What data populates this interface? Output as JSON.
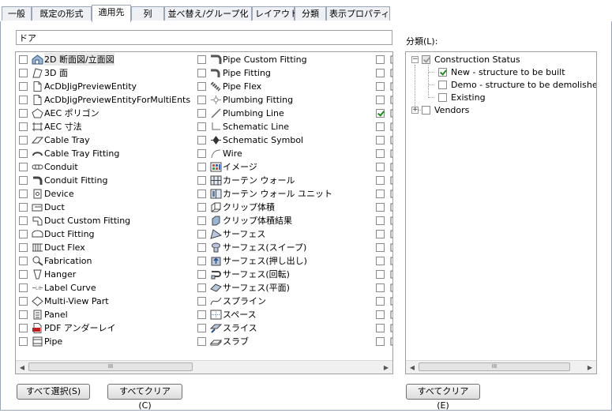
{
  "tabs": [
    "一般",
    "既定の形式",
    "適用先",
    "列",
    "並べ替え/グループ化",
    "レイアウト",
    "分類",
    "表示プロパティ"
  ],
  "active_tab": "適用先",
  "search": {
    "value": "ドア"
  },
  "objects": {
    "col1": [
      {
        "label": "2D 断面図/立面図",
        "checked": false,
        "icon": "section-elevation-icon",
        "selected": true
      },
      {
        "label": "3D 面",
        "checked": false,
        "icon": "3d-face-icon"
      },
      {
        "label": "AcDbJigPreviewEntity",
        "checked": false,
        "icon": "document-icon"
      },
      {
        "label": "AcDbJigPreviewEntityForMultiEnts",
        "checked": false,
        "icon": "document-icon"
      },
      {
        "label": "AEC ポリゴン",
        "checked": false,
        "icon": "polygon-icon"
      },
      {
        "label": "AEC 寸法",
        "checked": false,
        "icon": "dimension-icon"
      },
      {
        "label": "Cable Tray",
        "checked": false,
        "icon": "cable-tray-icon"
      },
      {
        "label": "Cable Tray Fitting",
        "checked": false,
        "icon": "cable-tray-fitting-icon"
      },
      {
        "label": "Conduit",
        "checked": false,
        "icon": "conduit-icon"
      },
      {
        "label": "Conduit Fitting",
        "checked": false,
        "icon": "conduit-fitting-icon"
      },
      {
        "label": "Device",
        "checked": false,
        "icon": "device-icon"
      },
      {
        "label": "Duct",
        "checked": false,
        "icon": "duct-icon"
      },
      {
        "label": "Duct Custom Fitting",
        "checked": false,
        "icon": "duct-custom-fitting-icon"
      },
      {
        "label": "Duct Fitting",
        "checked": false,
        "icon": "duct-fitting-icon"
      },
      {
        "label": "Duct Flex",
        "checked": false,
        "icon": "duct-flex-icon"
      },
      {
        "label": "Fabrication",
        "checked": false,
        "icon": "fabrication-icon"
      },
      {
        "label": "Hanger",
        "checked": false,
        "icon": "hanger-icon"
      },
      {
        "label": "Label Curve",
        "checked": false,
        "icon": "label-curve-icon"
      },
      {
        "label": "Multi-View Part",
        "checked": false,
        "icon": "multi-view-part-icon"
      },
      {
        "label": "Panel",
        "checked": false,
        "icon": "panel-icon"
      },
      {
        "label": "PDF アンダーレイ",
        "checked": false,
        "icon": "pdf-icon"
      },
      {
        "label": "Pipe",
        "checked": false,
        "icon": "pipe-icon"
      }
    ],
    "col2": [
      {
        "label": "Pipe Custom Fitting",
        "checked": false,
        "icon": "pipe-custom-fitting-icon"
      },
      {
        "label": "Pipe Fitting",
        "checked": false,
        "icon": "pipe-fitting-icon"
      },
      {
        "label": "Pipe Flex",
        "checked": false,
        "icon": "pipe-flex-icon"
      },
      {
        "label": "Plumbing Fitting",
        "checked": false,
        "icon": "plumbing-fitting-icon"
      },
      {
        "label": "Plumbing Line",
        "checked": false,
        "icon": "plumbing-line-icon"
      },
      {
        "label": "Schematic Line",
        "checked": false,
        "icon": "schematic-line-icon"
      },
      {
        "label": "Schematic Symbol",
        "checked": false,
        "icon": "schematic-symbol-icon"
      },
      {
        "label": "Wire",
        "checked": false,
        "icon": "wire-icon"
      },
      {
        "label": "イメージ",
        "checked": false,
        "icon": "image-icon"
      },
      {
        "label": "カーテン ウォール",
        "checked": false,
        "icon": "curtain-wall-icon"
      },
      {
        "label": "カーテン ウォール ユニット",
        "checked": false,
        "icon": "curtain-wall-unit-icon"
      },
      {
        "label": "クリップ体積",
        "checked": false,
        "icon": "clip-volume-icon"
      },
      {
        "label": "クリップ体積結果",
        "checked": false,
        "icon": "clip-volume-result-icon"
      },
      {
        "label": "サーフェス",
        "checked": false,
        "icon": "surface-icon"
      },
      {
        "label": "サーフェス(スイープ)",
        "checked": false,
        "icon": "surface-sweep-icon"
      },
      {
        "label": "サーフェス(押し出し)",
        "checked": false,
        "icon": "surface-extrude-icon"
      },
      {
        "label": "サーフェス(回転)",
        "checked": false,
        "icon": "surface-revolve-icon"
      },
      {
        "label": "サーフェス(平面)",
        "checked": false,
        "icon": "surface-planar-icon"
      },
      {
        "label": "スプライン",
        "checked": false,
        "icon": "spline-icon"
      },
      {
        "label": "スペース",
        "checked": false,
        "icon": "space-icon"
      },
      {
        "label": "スライス",
        "checked": false,
        "icon": "slice-icon"
      },
      {
        "label": "スラブ",
        "checked": false,
        "icon": "slab-icon"
      }
    ],
    "col3_checked": [
      false,
      false,
      false,
      false,
      true,
      false,
      false,
      false,
      false,
      false,
      false,
      false,
      false,
      false,
      false,
      false,
      false,
      false,
      false,
      false,
      false,
      false
    ]
  },
  "scrollbar": {
    "thumb_grip": "III"
  },
  "category": {
    "label": "分類(L):",
    "tree": [
      {
        "label": "Construction Status",
        "level": 0,
        "expander": "−",
        "checked": true,
        "grey": true
      },
      {
        "label": "New - structure to be built",
        "level": 1,
        "checked": true,
        "grey": false
      },
      {
        "label": "Demo - structure to be demolished",
        "level": 1,
        "checked": false,
        "grey": false
      },
      {
        "label": "Existing",
        "level": 1,
        "checked": false,
        "grey": false
      },
      {
        "label": "Vendors",
        "level": 0,
        "expander": "+",
        "checked": false,
        "grey": false
      }
    ]
  },
  "buttons": {
    "select_all": "すべて選択(S)",
    "clear_all": "すべてクリア(C)",
    "clear_all_category": "すべてクリア(E)"
  }
}
